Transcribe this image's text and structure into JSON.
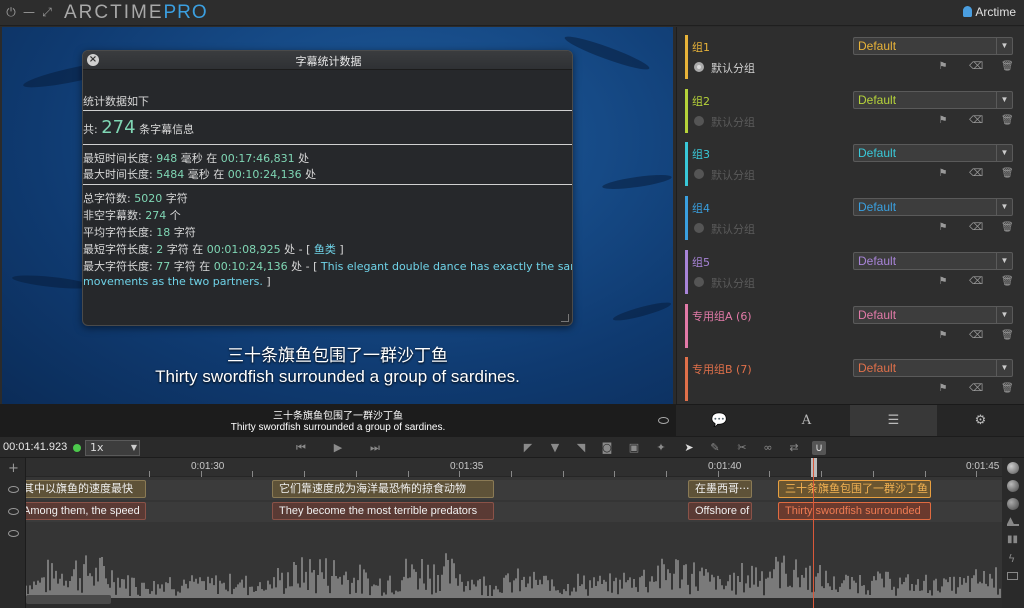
{
  "app": {
    "name": "ARCTIME",
    "edition": "PRO",
    "user": "Arctime"
  },
  "video": {
    "subtitle_zh": "三十条旗鱼包围了一群沙丁鱼",
    "subtitle_en": "Thirty swordfish surrounded a group of sardines."
  },
  "dialog": {
    "title": "字幕统计数据",
    "heading": "统计数据如下",
    "total": {
      "prefix": "共:",
      "count": "274",
      "suffix": "条字幕信息"
    },
    "min_duration": {
      "label": "最短时间长度:",
      "ms": "948",
      "unit": "毫秒 在",
      "at": "00:17:46,831",
      "tail": "处"
    },
    "max_duration": {
      "label": "最大时间长度:",
      "ms": "5484",
      "unit": "毫秒 在",
      "at": "00:10:24,136",
      "tail": "处"
    },
    "total_chars": {
      "label": "总字符数:",
      "value": "5020",
      "unit": "字符"
    },
    "nonempty": {
      "label": "非空字幕数:",
      "value": "274",
      "unit": "个"
    },
    "avg_chars": {
      "label": "平均字符长度:",
      "value": "18",
      "unit": "字符"
    },
    "min_chars": {
      "label": "最短字符长度:",
      "value": "2",
      "mid": "字符 在",
      "at": "00:01:08,925",
      "tail": "处 - [",
      "text": "鱼类",
      "close": "]"
    },
    "max_chars": {
      "label": "最大字符长度:",
      "value": "77",
      "mid": "字符 在",
      "at": "00:10:24,136",
      "tail": "处 - [",
      "text1": "This elegant double dance has exactly the same",
      "text2": "movements as the two partners.",
      "close": "]"
    }
  },
  "preview": {
    "zh": "三十条旗鱼包围了一群沙丁鱼",
    "en": "Thirty swordfish surrounded a group of sardines."
  },
  "groups": [
    {
      "name": "组1",
      "color": "#e8b339",
      "style": "Default",
      "sub": "默认分组",
      "sub_active": true
    },
    {
      "name": "组2",
      "color": "#b6d33a",
      "style": "Default",
      "sub": "默认分组",
      "sub_active": false
    },
    {
      "name": "组3",
      "color": "#39c8d8",
      "style": "Default",
      "sub": "默认分组",
      "sub_active": false
    },
    {
      "name": "组4",
      "color": "#3aa0e0",
      "style": "Default",
      "sub": "默认分组",
      "sub_active": false
    },
    {
      "name": "组5",
      "color": "#a884d8",
      "style": "Default",
      "sub": "默认分组",
      "sub_active": false
    },
    {
      "name": "专用组A (6)",
      "color": "#e27aa8",
      "style": "Default",
      "sub": "",
      "sub_active": false
    },
    {
      "name": "专用组B (7)",
      "color": "#e0704a",
      "style": "Default",
      "sub": "",
      "sub_active": false
    }
  ],
  "transport": {
    "timecode": "00:01:41.923",
    "speed": "1x"
  },
  "timeline": {
    "ticks": [
      "0:01:30",
      "0:01:35",
      "0:01:40",
      "0:01:45"
    ],
    "zh_subs": [
      {
        "text": "其中以旗鱼的速度最快"
      },
      {
        "text": "它们靠速度成为海洋最恐怖的掠食动物"
      },
      {
        "text": "在墨西哥···"
      },
      {
        "text": "三十条旗鱼包围了一群沙丁鱼"
      }
    ],
    "en_subs": [
      {
        "text": "Among them, the speed"
      },
      {
        "text": "They become the most terrible predators"
      },
      {
        "text": "Offshore of"
      },
      {
        "text": "Thirty swordfish surrounded"
      }
    ]
  }
}
